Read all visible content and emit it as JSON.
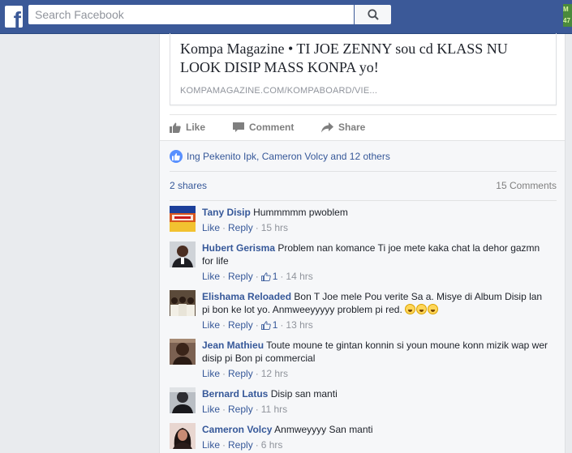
{
  "topbar": {
    "logo": "f",
    "search_placeholder": "Search Facebook",
    "corner_badge": "M 47"
  },
  "post": {
    "link_title": "Kompa Magazine • TI JOE ZENNY sou cd KLASS NU LOOK DISIP MASS KONPA yo!",
    "link_domain": "KOMPAMAGAZINE.COM/KOMPABOARD/VIE...",
    "actions": {
      "like": "Like",
      "comment": "Comment",
      "share": "Share"
    },
    "likes_text": "Ing Pekenito Ipk, Cameron Volcy and 12 others",
    "shares": "2 shares",
    "comments_count": "15 Comments"
  },
  "comments": [
    {
      "author": "Tany Disip",
      "text": "Hummmmm pwoblem",
      "like": "Like",
      "reply": "Reply",
      "likes": "",
      "time": "15 hrs"
    },
    {
      "author": "Hubert Gerisma",
      "text": "Problem nan komance Ti joe mete kaka chat la dehor gazmn for life",
      "like": "Like",
      "reply": "Reply",
      "likes": "1",
      "time": "14 hrs"
    },
    {
      "author": "Elishama Reloaded",
      "text": "Bon T Joe mele Pou verite Sa a. Misye di Album Disip lan pi bon ke lot yo. Anmweeyyyyy problem pi red.",
      "like": "Like",
      "reply": "Reply",
      "likes": "1",
      "time": "13 hrs"
    },
    {
      "author": "Jean Mathieu",
      "text": "Toute moune te gintan konnin si youn moune konn mizik wap wer disip pi Bon pi commercial",
      "like": "Like",
      "reply": "Reply",
      "likes": "",
      "time": "12 hrs"
    },
    {
      "author": "Bernard Latus",
      "text": "Disip san manti",
      "like": "Like",
      "reply": "Reply",
      "likes": "",
      "time": "11 hrs"
    },
    {
      "author": "Cameron Volcy",
      "text": "Anmweyyyy San manti",
      "like": "Like",
      "reply": "Reply",
      "likes": "",
      "time": "6 hrs"
    }
  ],
  "icons": {
    "search": "search-icon",
    "like": "thumbs-up-icon",
    "comment": "comment-bubble-icon",
    "share": "share-arrow-icon",
    "reaction": "like-reaction-icon",
    "emoji": "laughing-face-emoji"
  },
  "colors": {
    "brand": "#3b5998",
    "link": "#365899",
    "muted": "#90949c",
    "like_blue": "#5890ff"
  }
}
